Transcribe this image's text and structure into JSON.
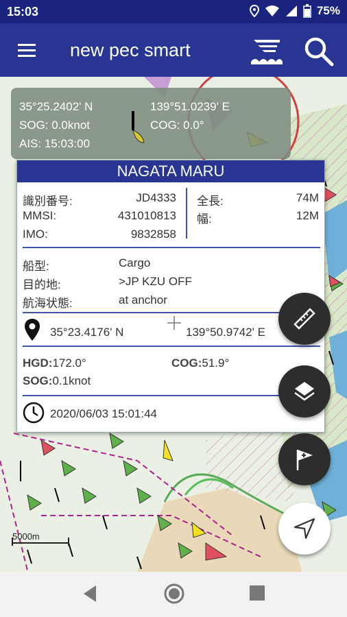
{
  "status_bar": {
    "time": "15:03",
    "battery": "75%"
  },
  "app_bar": {
    "title": "new pec smart"
  },
  "position_panel": {
    "lat": "35°25.2402' N",
    "lon": "139°51.0239' E",
    "sog": "SOG: 0.0knot",
    "cog": "COG: 0.0°",
    "ais": "AIS: 15:03:00"
  },
  "ship_card": {
    "name": "NAGATA MARU",
    "id_label": "識別番号:",
    "id_value": "JD4333",
    "mmsi_label": "MMSI:",
    "mmsi_value": "431010813",
    "imo_label": "IMO:",
    "imo_value": "9832858",
    "length_label": "全長:",
    "length_value": "74M",
    "width_label": "幅:",
    "width_value": "12M",
    "type_label": "船型:",
    "type_value": "Cargo",
    "dest_label": "目的地:",
    "dest_value": ">JP  KZU  OFF",
    "status_label": "航海状態:",
    "status_value": "at anchor",
    "ship_lat": "35°23.4176' N",
    "ship_lon": "139°50.9742' E",
    "hgd_label": "HGD:",
    "hgd_value": "172.0°",
    "cog_label": "COG:",
    "cog_value": "51.9°",
    "sog_label": "SOG:",
    "sog_value": "0.1knot",
    "timestamp": "2020/06/03 15:01:44"
  },
  "map": {
    "scale_label": "5000m"
  },
  "colors": {
    "app_bar": "#283593",
    "status_bar": "#1a237e",
    "fab": "#2d2d2d",
    "divider": "#3f51b5"
  }
}
